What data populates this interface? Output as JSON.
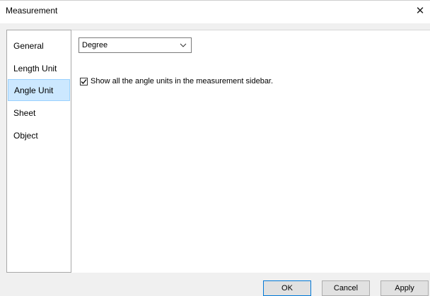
{
  "window": {
    "title": "Measurement"
  },
  "sidebar": {
    "items": [
      {
        "label": "General"
      },
      {
        "label": "Length Unit"
      },
      {
        "label": "Angle Unit",
        "selected": true
      },
      {
        "label": "Sheet"
      },
      {
        "label": "Object"
      }
    ]
  },
  "main": {
    "angle_unit_select": {
      "value": "Degree"
    },
    "show_all_checkbox": {
      "label": "Show all the angle units in the measurement sidebar.",
      "checked": true
    }
  },
  "footer": {
    "ok_label": "OK",
    "cancel_label": "Cancel",
    "apply_label": "Apply"
  },
  "colors": {
    "selection_bg": "#cce8ff",
    "selection_border": "#99d1ff",
    "default_button_border": "#0078d7"
  }
}
